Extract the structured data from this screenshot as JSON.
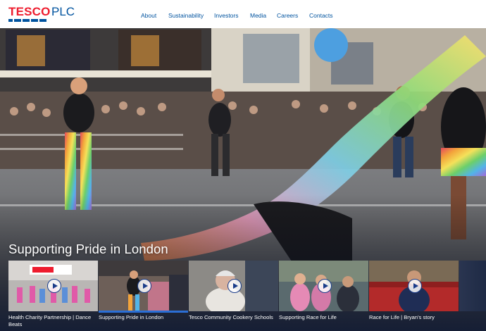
{
  "brand": {
    "name": "TESCO",
    "suffix": "PLC",
    "red": "#ee1c2e",
    "blue": "#00539f"
  },
  "nav": {
    "items": [
      "About",
      "Sustainability",
      "Investors",
      "Media",
      "Careers",
      "Contacts"
    ]
  },
  "hero": {
    "title": "Supporting Pride in London"
  },
  "videos": [
    {
      "label": "Health Charity Partnership | Dance Beats",
      "icon": "play-icon"
    },
    {
      "label": "Supporting Pride in London",
      "icon": "play-icon",
      "active": true
    },
    {
      "label": "Tesco Community Cookery Schools",
      "icon": "play-icon"
    },
    {
      "label": "Supporting Race for Life",
      "icon": "play-icon"
    },
    {
      "label": "Race for Life | Bryan's story",
      "icon": "play-icon"
    }
  ],
  "colors": {
    "active_indicator": "#2b6fd6",
    "label_text": "#ffffff"
  }
}
